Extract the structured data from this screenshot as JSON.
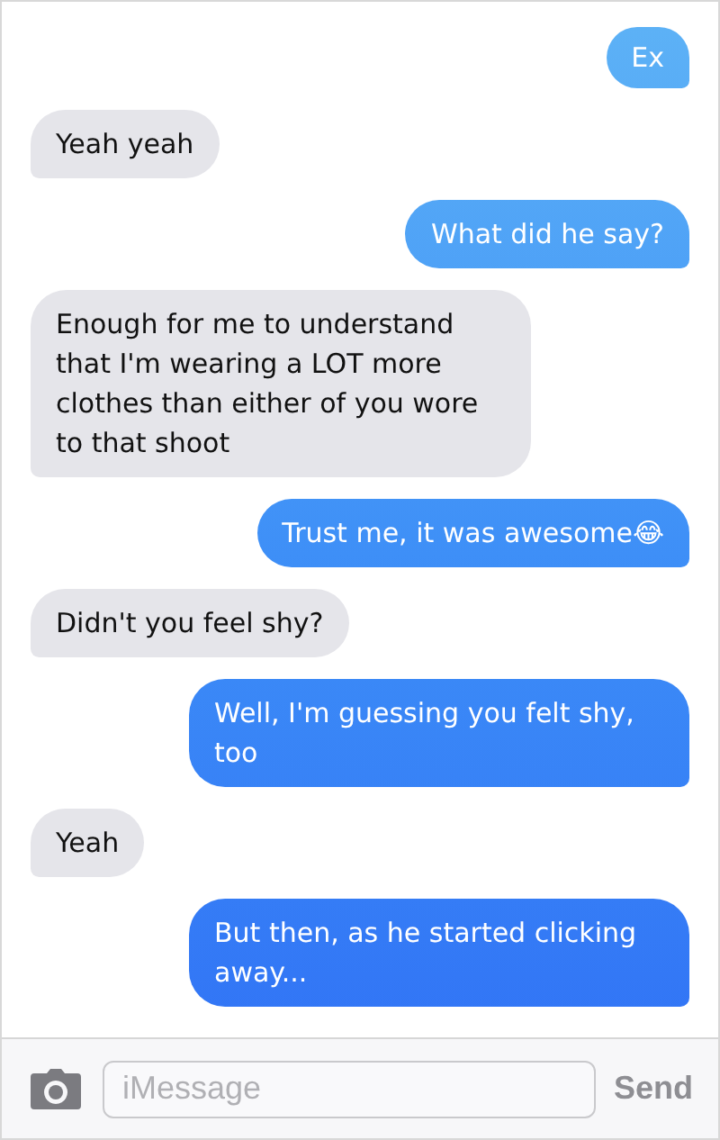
{
  "messages": [
    {
      "kind": "sent",
      "text": "Ex"
    },
    {
      "kind": "received",
      "text": "Yeah yeah"
    },
    {
      "kind": "sent",
      "text": "What did he say?"
    },
    {
      "kind": "received",
      "text": "Enough for me to understand that I'm wearing a LOT more clothes than either of you wore to that shoot"
    },
    {
      "kind": "sent",
      "text": "Trust me, it was awesome😂"
    },
    {
      "kind": "received",
      "text": "Didn't you feel shy?"
    },
    {
      "kind": "sent",
      "text": "Well, I'm guessing you felt shy, too"
    },
    {
      "kind": "received",
      "text": "Yeah"
    },
    {
      "kind": "sent",
      "text": "But then, as he started clicking away..."
    }
  ],
  "composer": {
    "placeholder": "iMessage",
    "send_label": "Send"
  }
}
